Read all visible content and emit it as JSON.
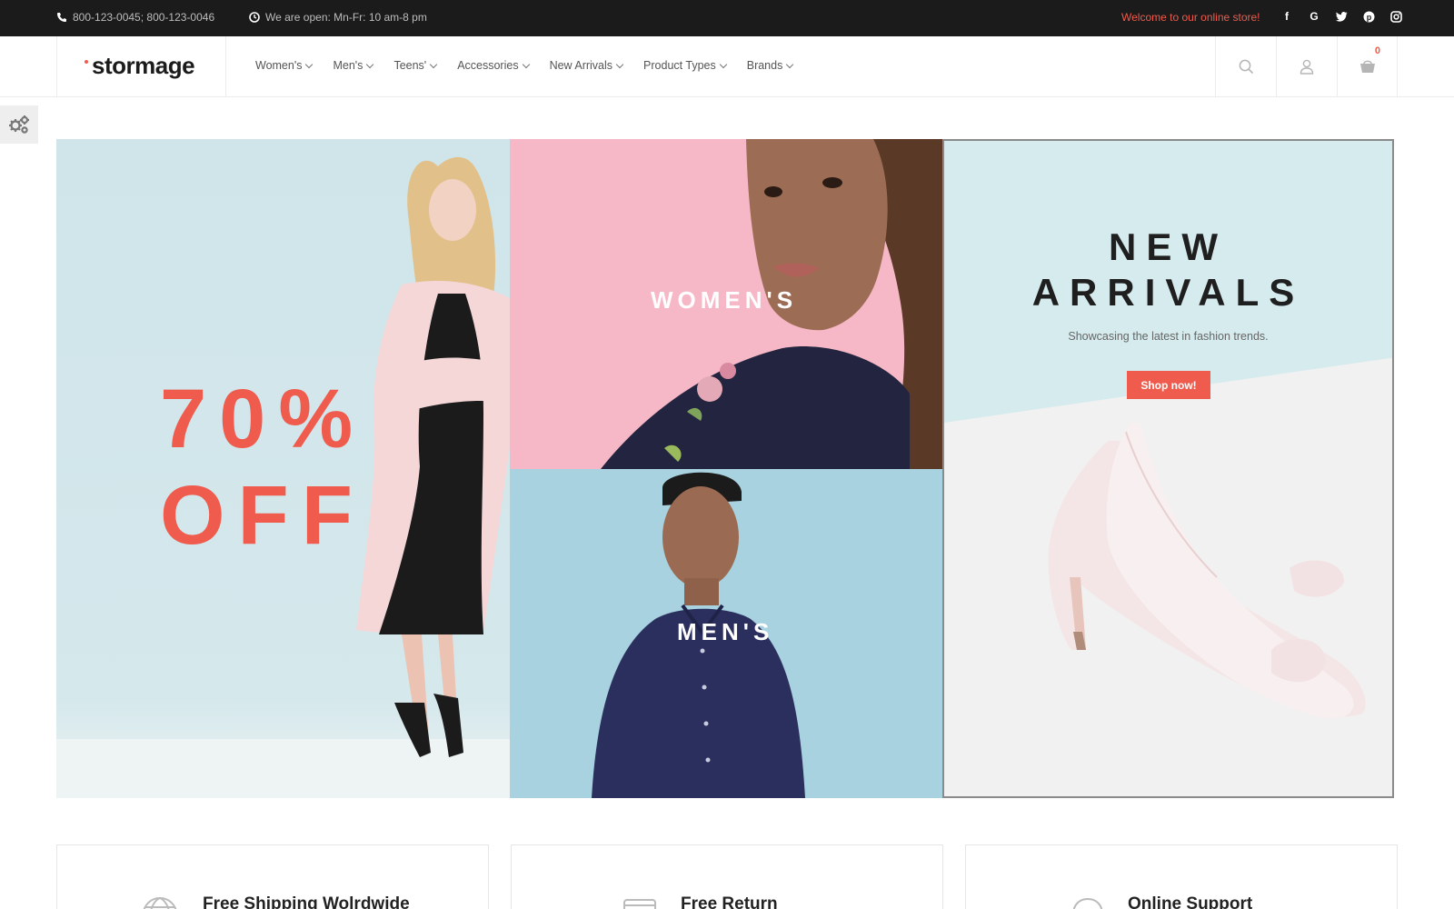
{
  "topbar": {
    "phone": "800-123-0045; 800-123-0046",
    "hours": "We are open: Mn-Fr: 10 am-8 pm",
    "welcome": "Welcome to our online store!",
    "socials": [
      "facebook-icon",
      "google-icon",
      "twitter-icon",
      "pinterest-icon",
      "instagram-icon"
    ]
  },
  "header": {
    "logo": "stormage",
    "nav": [
      "Women's",
      "Men's",
      "Teens'",
      "Accessories",
      "New Arrivals",
      "Product Types",
      "Brands"
    ],
    "cart_count": "0"
  },
  "hero": {
    "sale_line1": "70%",
    "sale_line2": "OFF",
    "womens_label": "WOMEN'S",
    "mens_label": "MEN'S",
    "new_arrivals_line1": "NEW",
    "new_arrivals_line2": "ARRIVALS",
    "new_arrivals_sub": "Showcasing the latest in fashion trends.",
    "shop_now": "Shop now!"
  },
  "features": [
    {
      "title": "Free Shipping Wolrdwide",
      "icon": "globe-icon"
    },
    {
      "title": "Free Return",
      "icon": "card-icon"
    },
    {
      "title": "Online Support",
      "icon": "support-icon"
    }
  ],
  "colors": {
    "accent": "#ef5b4c",
    "topbar_bg": "#1b1b1b",
    "panel_blue": "#cfe5ea",
    "panel_pink": "#f6b8c6"
  }
}
